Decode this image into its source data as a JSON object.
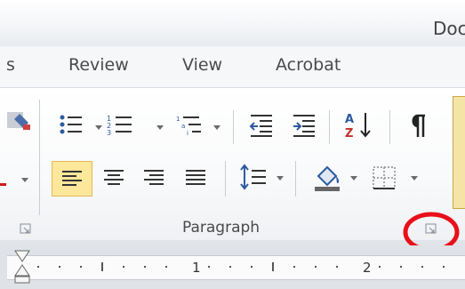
{
  "window": {
    "title": "Doc"
  },
  "tabs": [
    "s",
    "Review",
    "View",
    "Acrobat"
  ],
  "group": {
    "label": "Paragraph"
  },
  "ruler": {
    "numbers": [
      "1",
      "2"
    ]
  },
  "colors": {
    "highlight": "#fce79a",
    "annotation_circle": "#e8101a",
    "right_strip": "#f4e5a6"
  },
  "icons": [
    "bullets-icon",
    "numbering-icon",
    "multilevel-list-icon",
    "decrease-indent-icon",
    "increase-indent-icon",
    "sort-icon",
    "show-marks-icon",
    "align-left-icon",
    "center-icon",
    "align-right-icon",
    "justify-icon",
    "line-spacing-icon",
    "shading-icon",
    "borders-icon",
    "dialog-launcher-icon"
  ]
}
